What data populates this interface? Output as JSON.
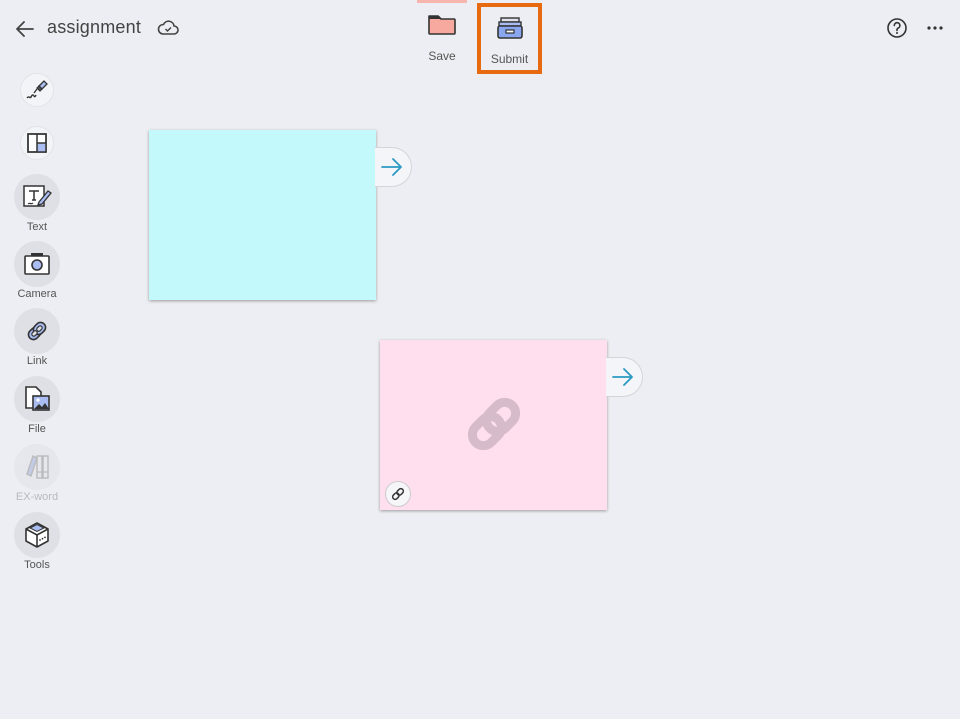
{
  "header": {
    "title": "assignment",
    "back_icon": "arrow-left-icon",
    "sync_icon": "cloud-check-icon"
  },
  "toolbar": {
    "save_label": "Save",
    "submit_label": "Submit",
    "help_icon": "help-circle-icon",
    "more_icon": "more-horizontal-icon",
    "highlight_color": "#e86a10"
  },
  "sidebar": {
    "items": [
      {
        "label": "",
        "icon": "pen-icon"
      },
      {
        "label": "",
        "icon": "layout-icon"
      },
      {
        "label": "Text",
        "icon": "text-icon"
      },
      {
        "label": "Camera",
        "icon": "camera-icon"
      },
      {
        "label": "Link",
        "icon": "link-icon"
      },
      {
        "label": "File",
        "icon": "file-image-icon"
      },
      {
        "label": "EX-word",
        "icon": "ex-word-icon",
        "disabled": true
      },
      {
        "label": "Tools",
        "icon": "toolbox-icon"
      }
    ]
  },
  "canvas": {
    "cards": [
      {
        "type": "blank",
        "color": "#c4f9fc"
      },
      {
        "type": "link",
        "color": "#ffdfee"
      }
    ]
  }
}
